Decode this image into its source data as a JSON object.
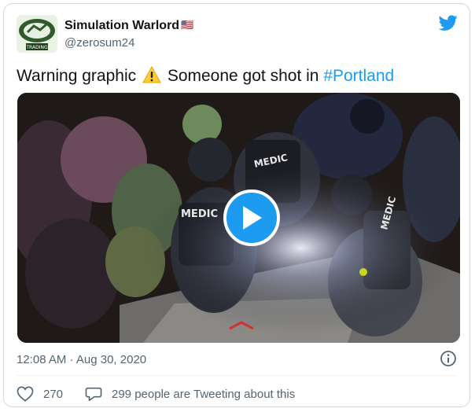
{
  "author": {
    "name": "Simulation Warlord",
    "handle": "@zerosum24",
    "flag": "🇺🇸",
    "avatar_text": "TRADING"
  },
  "tweet": {
    "text_before": "Warning graphic",
    "text_after": "Someone got shot in",
    "hashtag": "#Portland"
  },
  "media": {
    "vest_labels": [
      "MEDIC",
      "MEDIC",
      "MEDIC"
    ],
    "play_icon": "play-icon"
  },
  "meta": {
    "timestamp": "12:08 AM · Aug 30, 2020"
  },
  "actions": {
    "likes": "270",
    "conversation": "299 people are Tweeting about this"
  },
  "colors": {
    "accent": "#1d9bf0",
    "secondary_text": "#536471",
    "like_icon": "#536471"
  }
}
